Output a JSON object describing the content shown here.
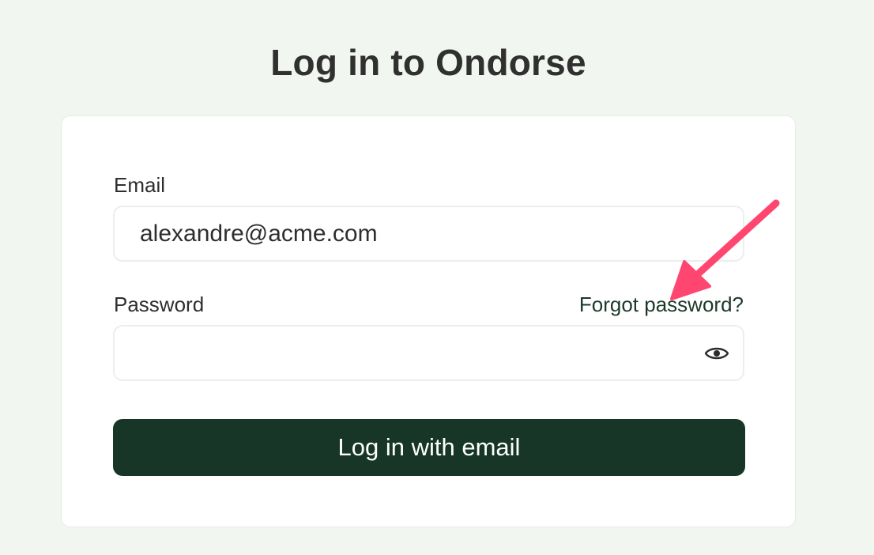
{
  "page": {
    "title": "Log in to Ondorse"
  },
  "form": {
    "email": {
      "label": "Email",
      "value": "alexandre@acme.com",
      "placeholder": ""
    },
    "password": {
      "label": "Password",
      "value": "",
      "placeholder": "",
      "forgot_link": "Forgot password?",
      "toggle_icon": "eye-icon"
    },
    "submit_label": "Log in with email"
  },
  "colors": {
    "background": "#f2f6f0",
    "card": "#ffffff",
    "primary_button": "#173628",
    "link": "#1c3a2a",
    "annotation_arrow": "#ff4670"
  }
}
